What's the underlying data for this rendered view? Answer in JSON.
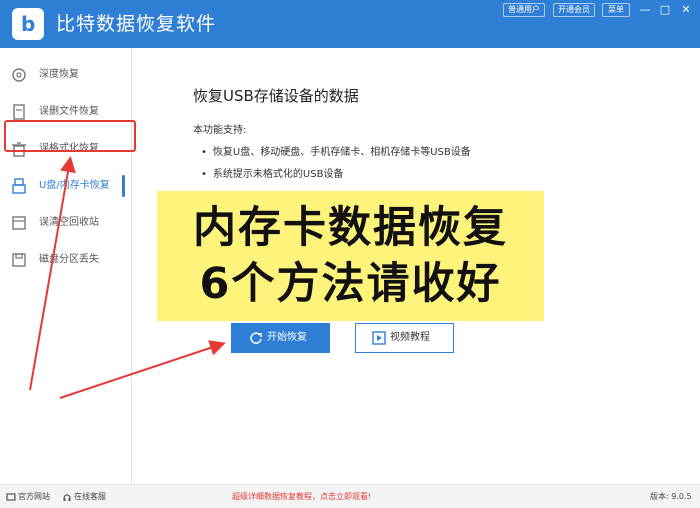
{
  "app": {
    "title": "比特数据恢复软件",
    "logo_letter": "b",
    "accent_color": "#2f7fd6"
  },
  "topbar": {
    "user_type": "普通用户",
    "open_member": "开通会员",
    "menu": "菜单",
    "minimize": "—",
    "maximize": "□",
    "close": "✕"
  },
  "sidebar": {
    "items": [
      {
        "label": "深度恢复",
        "icon": "refresh-icon"
      },
      {
        "label": "误删文件恢复",
        "icon": "file-icon"
      },
      {
        "label": "误格式化恢复",
        "icon": "trash-icon"
      },
      {
        "label": "U盘/内存卡恢复",
        "icon": "usb-icon",
        "active": true
      },
      {
        "label": "误清空回收站",
        "icon": "recycle-bin-icon"
      },
      {
        "label": "磁盘分区丢失",
        "icon": "disk-icon"
      }
    ]
  },
  "main": {
    "title": "恢复USB存储设备的数据",
    "intro": "本功能支持:",
    "bullets": [
      "恢复U盘、移动硬盘、手机存储卡、相机存储卡等USB设备",
      "系统提示未格式化的USB设备"
    ],
    "start_button": "开始恢复",
    "video_button": "视频教程"
  },
  "overlay": {
    "line1": "内存卡数据恢复",
    "line2": "6个方法请收好",
    "background": "#fff47b"
  },
  "annotation": {
    "highlight_color": "#e53935"
  },
  "footer": {
    "website": "官方网站",
    "online_help": "在线客服",
    "promo": "超级详细数据恢复教程，点击立即观看!",
    "version": "版本: 9.0.5"
  }
}
